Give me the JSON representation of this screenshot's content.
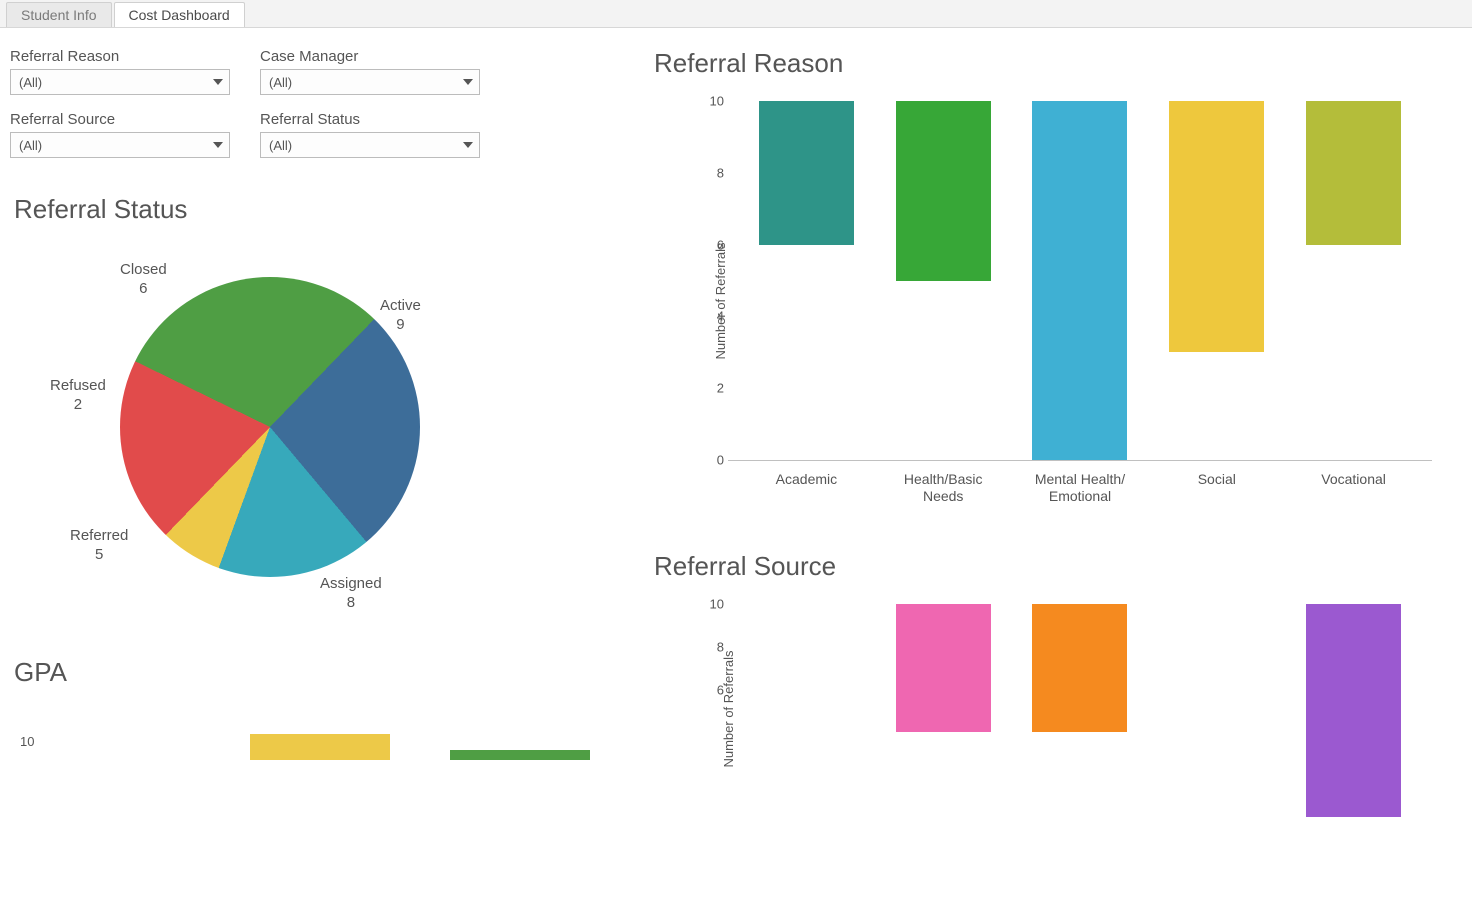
{
  "tabs": [
    {
      "label": "Student Info",
      "active": false
    },
    {
      "label": "Cost Dashboard",
      "active": true
    }
  ],
  "filters": {
    "referral_reason": {
      "label": "Referral Reason",
      "value": "(All)"
    },
    "case_manager": {
      "label": "Case Manager",
      "value": "(All)"
    },
    "referral_source": {
      "label": "Referral Source",
      "value": "(All)"
    },
    "referral_status": {
      "label": "Referral Status",
      "value": "(All)"
    }
  },
  "pie": {
    "title": "Referral Status",
    "labels": {
      "active": {
        "name": "Active",
        "value": "9"
      },
      "assigned": {
        "name": "Assigned",
        "value": "8"
      },
      "referred": {
        "name": "Referred",
        "value": "5"
      },
      "refused": {
        "name": "Refused",
        "value": "2"
      },
      "closed": {
        "name": "Closed",
        "value": "6"
      }
    }
  },
  "gpa": {
    "title": "GPA",
    "y_tick": "10"
  },
  "reason_chart": {
    "title": "Referral Reason",
    "ylabel": "Number of Referrals",
    "ticks": {
      "t0": "0",
      "t2": "2",
      "t4": "4",
      "t6": "6",
      "t8": "8",
      "t10": "10"
    },
    "xlabels": {
      "c0": "Academic",
      "c1": "Health/Basic\nNeeds",
      "c2": "Mental Health/\nEmotional",
      "c3": "Social",
      "c4": "Vocational"
    }
  },
  "source_chart": {
    "title": "Referral Source",
    "ylabel": "Number of Referrals",
    "ticks": {
      "t6": "6",
      "t8": "8",
      "t10": "10"
    }
  },
  "chart_data": [
    {
      "type": "pie",
      "title": "Referral Status",
      "categories": [
        "Active",
        "Assigned",
        "Referred",
        "Refused",
        "Closed"
      ],
      "values": [
        9,
        8,
        5,
        2,
        6
      ],
      "colors": [
        "#4f9e44",
        "#3d6d99",
        "#37a9bb",
        "#edc948",
        "#e14b4b"
      ]
    },
    {
      "type": "bar",
      "title": "Referral Reason",
      "ylabel": "Number of Referrals",
      "ylim": [
        0,
        10
      ],
      "categories": [
        "Academic",
        "Health/Basic Needs",
        "Mental Health/Emotional",
        "Social",
        "Vocational"
      ],
      "values": [
        4,
        5,
        10,
        7,
        4
      ],
      "colors": [
        "#2e9488",
        "#37a737",
        "#3fb0d3",
        "#eec83d",
        "#b4bd3a"
      ]
    },
    {
      "type": "bar",
      "title": "Referral Source",
      "ylabel": "Number of Referrals",
      "ylim": [
        0,
        10
      ],
      "categories": [
        "",
        "",
        "",
        "",
        ""
      ],
      "values": [
        null,
        6,
        6,
        null,
        10
      ],
      "colors": [
        "",
        "#ef67b1",
        "#f58a1f",
        "",
        "#9b59d0"
      ]
    },
    {
      "type": "bar",
      "title": "GPA",
      "ylabel": "",
      "ylim": [
        0,
        10
      ],
      "categories": [],
      "values": [],
      "colors": []
    }
  ]
}
